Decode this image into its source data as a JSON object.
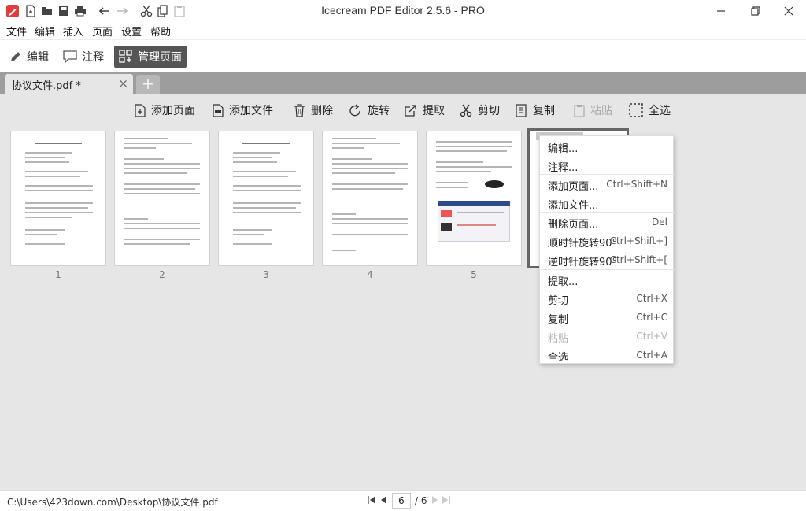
{
  "app": {
    "title": "Icecream PDF Editor 2.5.6 - PRO"
  },
  "menu": [
    "文件",
    "编辑",
    "插入",
    "页面",
    "设置",
    "帮助"
  ],
  "modes": {
    "edit": "编辑",
    "annotate": "注释",
    "manage": "管理页面"
  },
  "tab": {
    "label": "协议文件.pdf *"
  },
  "page_toolbar": {
    "add_page": "添加页面",
    "add_file": "添加文件",
    "delete": "删除",
    "rotate": "旋转",
    "extract": "提取",
    "cut": "剪切",
    "copy": "复制",
    "paste": "粘贴",
    "select_all": "全选"
  },
  "thumbnails": [
    "1",
    "2",
    "3",
    "4",
    "5"
  ],
  "context_menu": [
    {
      "label": "编辑...",
      "shortcut": ""
    },
    {
      "label": "注释...",
      "shortcut": ""
    },
    {
      "label": "添加页面...",
      "shortcut": "Ctrl+Shift+N"
    },
    {
      "label": "添加文件...",
      "shortcut": ""
    },
    {
      "label": "删除页面...",
      "shortcut": "Del"
    },
    {
      "label": "顺时针旋转90°",
      "shortcut": "Ctrl+Shift+]"
    },
    {
      "label": "逆时针旋转90°",
      "shortcut": "Ctrl+Shift+["
    },
    {
      "label": "提取...",
      "shortcut": ""
    },
    {
      "label": "剪切",
      "shortcut": "Ctrl+X"
    },
    {
      "label": "复制",
      "shortcut": "Ctrl+C"
    },
    {
      "label": "粘贴",
      "shortcut": "Ctrl+V"
    },
    {
      "label": "全选",
      "shortcut": "Ctrl+A"
    }
  ],
  "status": {
    "path": "C:\\Users\\423down.com\\Desktop\\协议文件.pdf",
    "current_page": "6",
    "total_pages": "/ 6"
  },
  "colors": {
    "accent": "#e23b3b",
    "active_mode": "#555555"
  }
}
